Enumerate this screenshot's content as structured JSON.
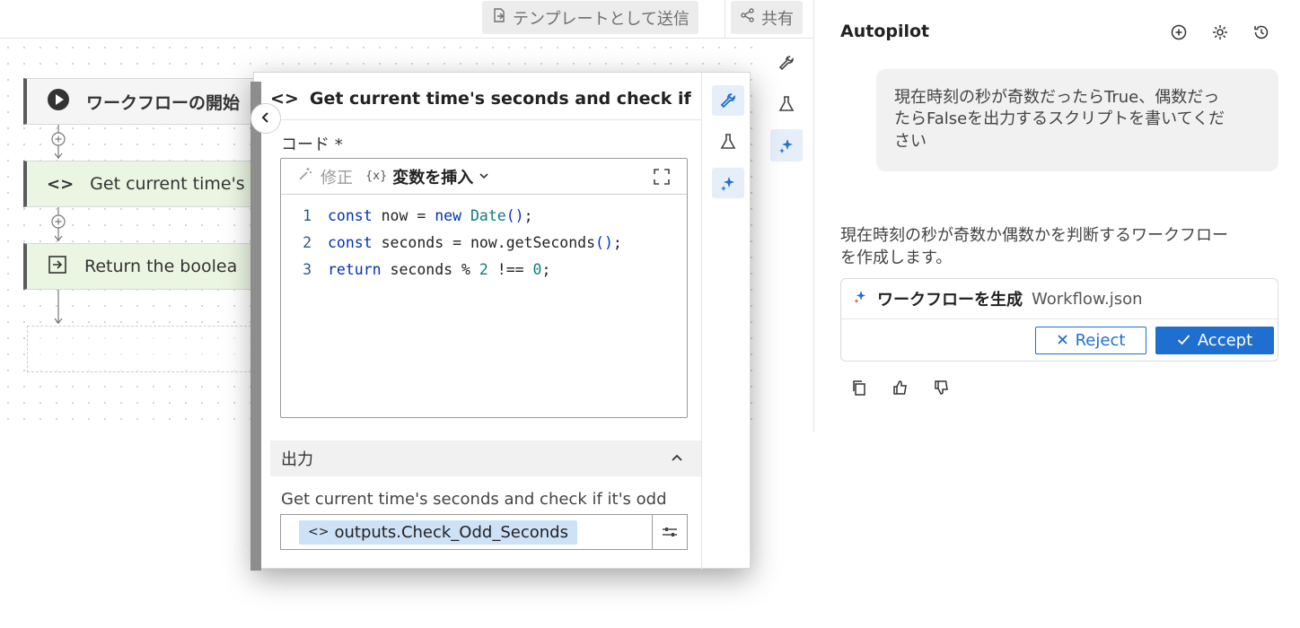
{
  "toolbar": {
    "send_as_template": "テンプレートとして送信",
    "share": "共有"
  },
  "canvas": {
    "nodes": [
      {
        "label": "ワークフローの開始"
      },
      {
        "label": "Get current time's"
      },
      {
        "label": "Return the boolea"
      }
    ]
  },
  "panel": {
    "title": "Get current time's seconds and check if ...",
    "code_label": "コード *",
    "fix_label": "修正",
    "insert_braces": "{x}",
    "insert_label": "変数を挿入",
    "code_lines": [
      {
        "num": "1",
        "kw": "const",
        "rest1": " now = ",
        "kw2": "new",
        "fn": " Date",
        "par": "()",
        "tail": ";"
      },
      {
        "num": "2",
        "kw": "const",
        "rest1": " seconds = now.",
        "fn": "getSeconds",
        "par": "()",
        "tail": ";"
      },
      {
        "num": "3",
        "kw": "return",
        "rest1": " seconds % ",
        "n1": "2",
        "mid": " !== ",
        "n2": "0",
        "tail": ";"
      }
    ],
    "output_header": "出力",
    "output_desc": "Get current time's seconds and check if it's odd",
    "output_chip_prefix": "<>",
    "output_chip": "outputs.Check_Odd_Seconds"
  },
  "autopilot": {
    "title": "Autopilot",
    "user_message": "現在時刻の秒が奇数だったらTrue、偶数だったらFalseを出力するスクリプトを書いてください",
    "bot_message": "現在時刻の秒が奇数か偶数かを判断するワークフローを作成します。",
    "card_title": "ワークフローを生成",
    "card_file": "Workflow.json",
    "reject_label": "Reject",
    "accept_label": "Accept"
  },
  "icons": {
    "top": [
      "send-template-icon",
      "share-icon"
    ],
    "canvas_tools": [
      "wrench-icon",
      "flask-icon",
      "sparkle-icon"
    ],
    "autopilot": [
      "new-chat-icon",
      "gear-icon",
      "history-icon"
    ],
    "feedback": [
      "copy-icon",
      "thumbs-up-icon",
      "thumbs-down-icon"
    ]
  },
  "colors": {
    "accent": "#1f6fd0",
    "node_green": "#eaf6e2",
    "chip": "#cde1f7"
  }
}
